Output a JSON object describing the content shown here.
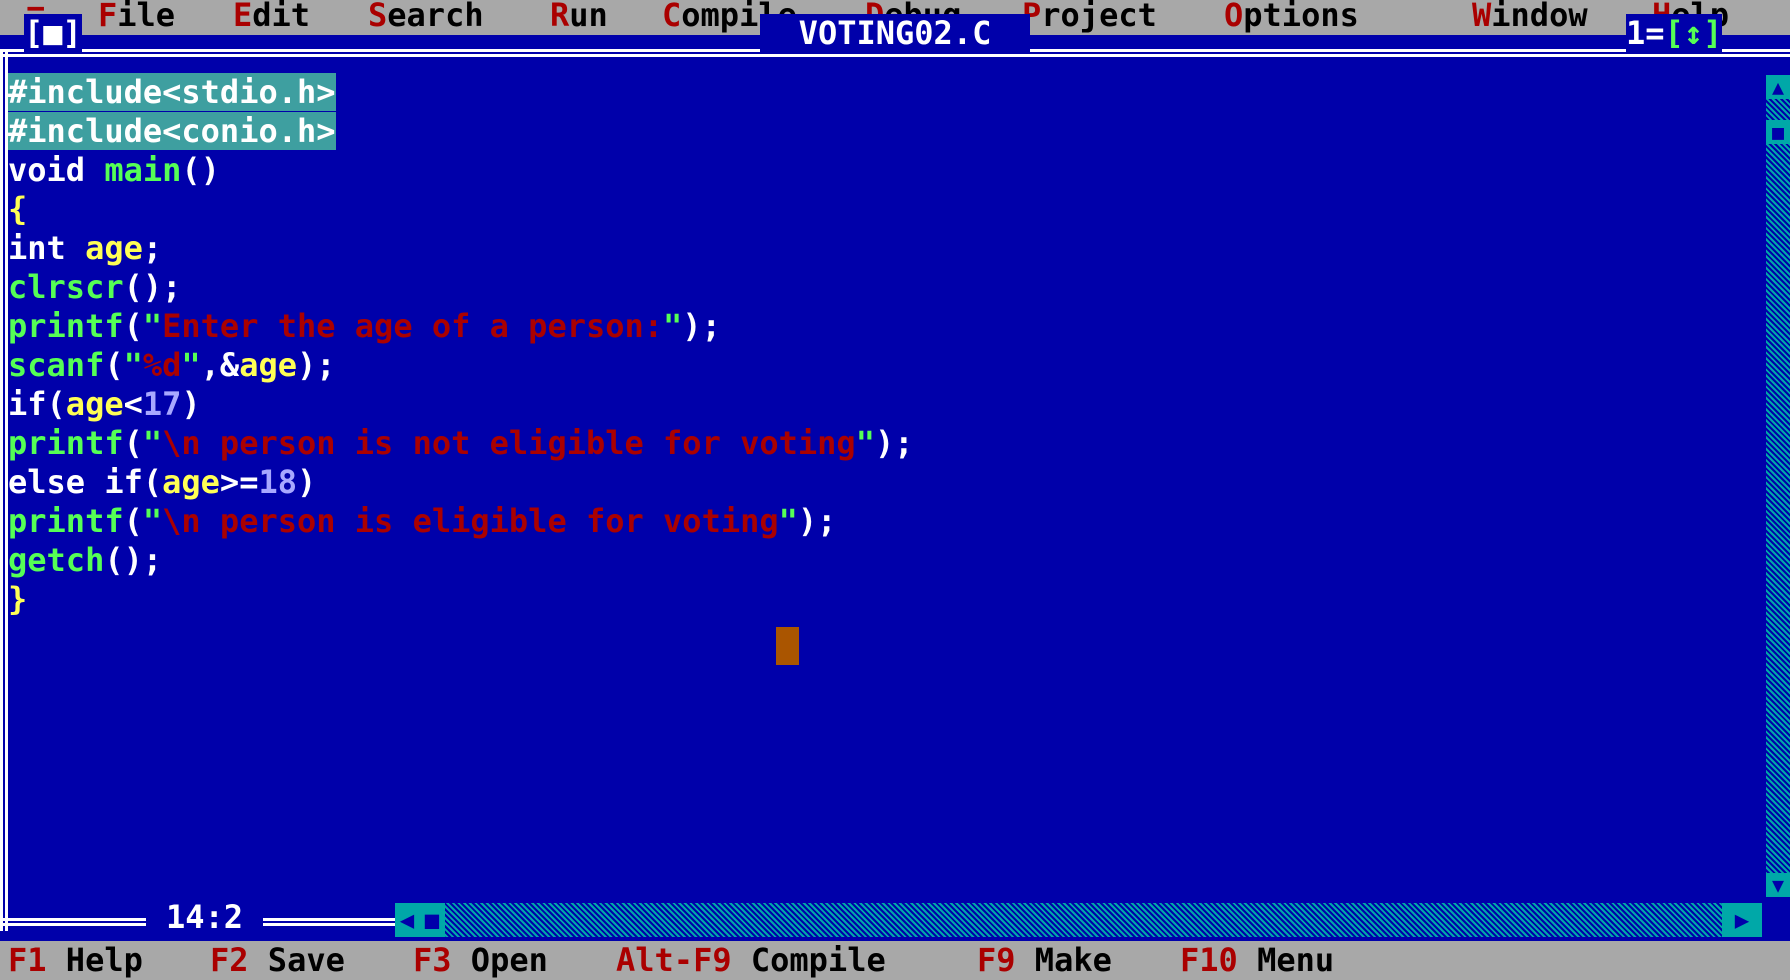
{
  "menu": {
    "system": "≡",
    "items": [
      {
        "hot": "F",
        "rest": "ile"
      },
      {
        "hot": "E",
        "rest": "dit"
      },
      {
        "hot": "S",
        "rest": "earch"
      },
      {
        "hot": "R",
        "rest": "un"
      },
      {
        "hot": "C",
        "rest": "ompile"
      },
      {
        "hot": "D",
        "rest": "ebug"
      },
      {
        "hot": "P",
        "rest": "roject"
      },
      {
        "hot": "O",
        "rest": "ptions"
      },
      {
        "hot": "W",
        "rest": "indow"
      },
      {
        "hot": "H",
        "rest": "elp"
      }
    ]
  },
  "window": {
    "close_box": "[■]",
    "title": "VOTING02.C",
    "number": "1",
    "zoom_box": "[↕]"
  },
  "code": [
    "#include<stdio.h>",
    "#include<conio.h>",
    "void main()",
    "{",
    "int age;",
    "clrscr();",
    "printf(\"Enter the age of a person:\");",
    "scanf(\"%d\",&age);",
    "if(age<17)",
    "printf(\"\\n person is not eligible for voting\");",
    "else if(age>=18)",
    "printf(\"\\n person is eligible for voting\");",
    "getch();",
    "}"
  ],
  "cursor_position": "14:2",
  "scroll": {
    "up_arrow": "▲",
    "down_arrow": "▼",
    "left_arrow": "◀",
    "right_arrow": "▶",
    "thumb": "■"
  },
  "hotkeys": [
    {
      "key": "F1",
      "label": "Help"
    },
    {
      "key": "F2",
      "label": "Save"
    },
    {
      "key": "F3",
      "label": "Open"
    },
    {
      "key": "Alt-F9",
      "label": "Compile"
    },
    {
      "key": "F9",
      "label": "Make"
    },
    {
      "key": "F10",
      "label": "Menu"
    }
  ],
  "colors": {
    "editor_bg": "#0000AA",
    "menu_bg": "#A8A8A8",
    "hotkey_red": "#AA0000",
    "selection_bg": "#3E9FA0",
    "cursor": "#AA5500"
  }
}
